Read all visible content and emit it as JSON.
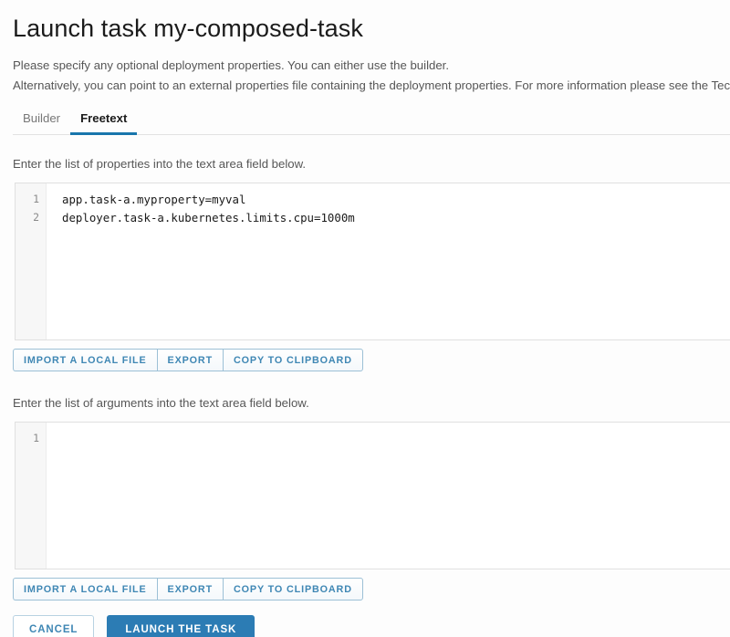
{
  "header": {
    "title": "Launch task my-composed-task"
  },
  "intro": {
    "line1": "Please specify any optional deployment properties. You can either use the builder.",
    "line2": "Alternatively, you can point to an external properties file containing the deployment properties. For more information please see the Techn"
  },
  "tabs": [
    {
      "label": "Builder",
      "active": false
    },
    {
      "label": "Freetext",
      "active": true
    }
  ],
  "properties_section": {
    "label": "Enter the list of properties into the text area field below.",
    "line_numbers": [
      "1",
      "2"
    ],
    "lines": [
      "app.task-a.myproperty=myval",
      "deployer.task-a.kubernetes.limits.cpu=1000m"
    ],
    "buttons": [
      "IMPORT A LOCAL FILE",
      "EXPORT",
      "COPY TO CLIPBOARD"
    ]
  },
  "arguments_section": {
    "label": "Enter the list of arguments into the text area field below.",
    "line_numbers": [
      "1"
    ],
    "lines": [
      ""
    ],
    "buttons": [
      "IMPORT A LOCAL FILE",
      "EXPORT",
      "COPY TO CLIPBOARD"
    ]
  },
  "footer": {
    "cancel_label": "CANCEL",
    "launch_label": "LAUNCH THE TASK"
  },
  "colors": {
    "accent": "#2c7cb4",
    "tab_underline": "#1876ac",
    "link_blue": "#3f87b4",
    "text": "#313131",
    "muted_text": "#565656",
    "editor_bg": "#ffffff",
    "gutter_bg": "#f7f7f7",
    "page_bg": "#fdfdfd"
  }
}
